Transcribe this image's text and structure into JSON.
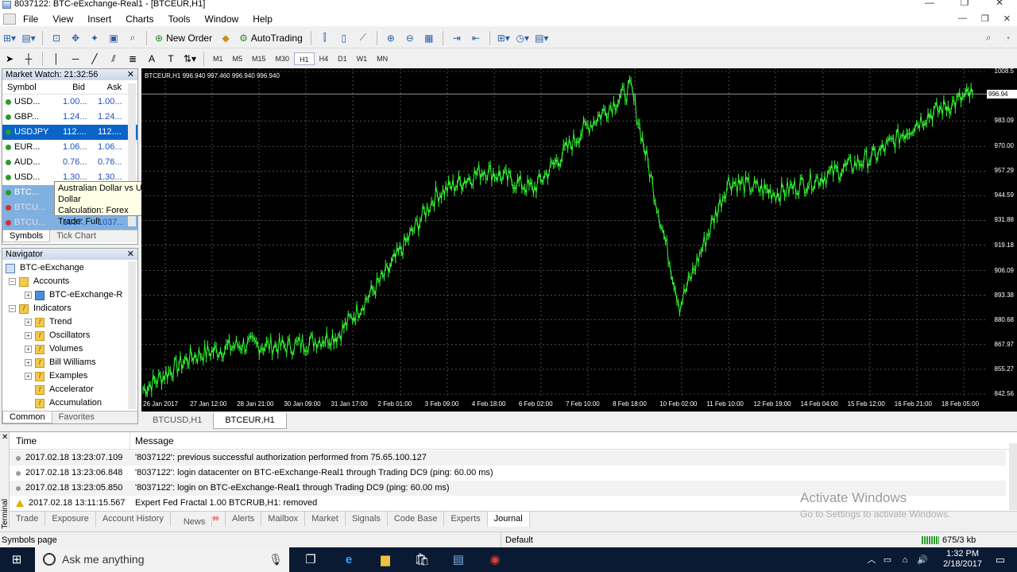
{
  "window": {
    "title": "8037122: BTC-eExchange-Real1 - [BTCEUR,H1]"
  },
  "menu": [
    "File",
    "View",
    "Insert",
    "Charts",
    "Tools",
    "Window",
    "Help"
  ],
  "toolbar": {
    "new_order": "New Order",
    "autotrading": "AutoTrading"
  },
  "timeframes": [
    "M1",
    "M5",
    "M15",
    "M30",
    "H1",
    "H4",
    "D1",
    "W1",
    "MN"
  ],
  "market_watch": {
    "title": "Market Watch: 21:32:56",
    "headers": {
      "symbol": "Symbol",
      "bid": "Bid",
      "ask": "Ask"
    },
    "rows": [
      {
        "symbol": "USD...",
        "bid": "1.00...",
        "ask": "1.00..."
      },
      {
        "symbol": "GBP...",
        "bid": "1.24...",
        "ask": "1.24..."
      },
      {
        "symbol": "USDJPY",
        "bid": "112....",
        "ask": "112...."
      },
      {
        "symbol": "EUR...",
        "bid": "1.06...",
        "ask": "1.06..."
      },
      {
        "symbol": "AUD...",
        "bid": "0.76...",
        "ask": "0.76..."
      },
      {
        "symbol": "USD...",
        "bid": "1.30...",
        "ask": "1.30..."
      },
      {
        "symbol": "BTC...",
        "bid": "",
        "ask": ""
      },
      {
        "symbol": "BTCU...",
        "bid": "",
        "ask": ""
      },
      {
        "symbol": "BTCU...",
        "bid": "1037....",
        "ask": "1037...."
      }
    ],
    "tabs": [
      "Symbols",
      "Tick Chart"
    ],
    "tooltip": {
      "line1": "Australian Dollar vs US Dollar",
      "line2": "Calculation: Forex",
      "line3": "Trade: Full"
    }
  },
  "navigator": {
    "title": "Navigator",
    "items": [
      {
        "label": "BTC-eExchange"
      },
      {
        "label": "Accounts"
      },
      {
        "label": "BTC-eExchange-R"
      },
      {
        "label": "Indicators"
      },
      {
        "label": "Trend"
      },
      {
        "label": "Oscillators"
      },
      {
        "label": "Volumes"
      },
      {
        "label": "Bill Williams"
      },
      {
        "label": "Examples"
      },
      {
        "label": "Accelerator"
      },
      {
        "label": "Accumulation"
      }
    ],
    "tabs": [
      "Common",
      "Favorites"
    ]
  },
  "chart": {
    "title": "BTCEUR,H1  996.940 997.460 996.940 996.940",
    "current_price": "996.94",
    "y_ticks": [
      "1008.5",
      "996.94",
      "983.09",
      "970.00",
      "957.29",
      "944.59",
      "931.88",
      "919.18",
      "906.09",
      "893.38",
      "880.68",
      "867.97",
      "855.27",
      "842.56"
    ],
    "x_ticks": [
      "26 Jan 2017",
      "27 Jan 12:00",
      "28 Jan 21:00",
      "30 Jan 09:00",
      "31 Jan 17:00",
      "2 Feb 01:00",
      "3 Feb 09:00",
      "4 Feb 18:00",
      "6 Feb 02:00",
      "7 Feb 10:00",
      "8 Feb 18:00",
      "10 Feb 02:00",
      "11 Feb 10:00",
      "12 Feb 19:00",
      "14 Feb 04:00",
      "15 Feb 12:00",
      "16 Feb 21:00",
      "18 Feb 05:00"
    ],
    "tabs": [
      "BTCUSD,H1",
      "BTCEUR,H1"
    ],
    "color": "#33ff33"
  },
  "chart_data": {
    "type": "line",
    "title": "BTCEUR,H1",
    "x": [
      "26 Jan 2017",
      "27 Jan 12:00",
      "28 Jan 21:00",
      "30 Jan 09:00",
      "31 Jan 17:00",
      "2 Feb 01:00",
      "3 Feb 09:00",
      "4 Feb 18:00",
      "6 Feb 02:00",
      "7 Feb 10:00",
      "8 Feb 18:00",
      "10 Feb 02:00",
      "11 Feb 10:00",
      "12 Feb 19:00",
      "14 Feb 04:00",
      "15 Feb 12:00",
      "16 Feb 21:00",
      "18 Feb 05:00"
    ],
    "values": [
      845,
      862,
      868,
      867,
      873,
      905,
      945,
      958,
      948,
      978,
      1000,
      888,
      952,
      946,
      955,
      965,
      985,
      996.94
    ],
    "ylim": [
      842.56,
      1008.5
    ]
  },
  "terminal": {
    "side_label": "Terminal",
    "headers": {
      "time": "Time",
      "message": "Message"
    },
    "rows": [
      {
        "time": "2017.02.18 13:23:07.109",
        "message": "'8037122': previous successful authorization performed from 75.65.100.127"
      },
      {
        "time": "2017.02.18 13:23:06.848",
        "message": "'8037122': login datacenter on BTC-eExchange-Real1 through Trading DC9 (ping: 60.00 ms)"
      },
      {
        "time": "2017.02.18 13:23:05.850",
        "message": "'8037122': login on BTC-eExchange-Real1 through Trading DC9 (ping: 60.00 ms)"
      },
      {
        "time": "2017.02.18 13:11:15.567",
        "message": "Expert Fed Fractal 1.00 BTCRUB,H1: removed"
      }
    ],
    "tabs": [
      "Trade",
      "Exposure",
      "Account History",
      "News",
      "Alerts",
      "Mailbox",
      "Market",
      "Signals",
      "Code Base",
      "Experts",
      "Journal"
    ],
    "news_badge": "99"
  },
  "watermark": {
    "line1": "Activate Windows",
    "line2": "Go to Settings to activate Windows."
  },
  "status": {
    "left": "Symbols page",
    "profile": "Default",
    "traffic": "675/3 kb"
  },
  "taskbar": {
    "search_placeholder": "Ask me anything",
    "time": "1:32 PM",
    "date": "2/18/2017"
  }
}
